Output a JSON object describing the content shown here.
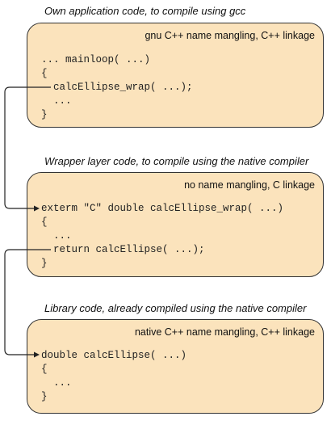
{
  "sections": [
    {
      "caption": "Own application code, to compile using gcc",
      "title": "gnu C++ name mangling, C++ linkage",
      "lines": [
        "... mainloop( ...)",
        "{",
        "  calcEllipse_wrap( ...);",
        "  ...",
        "}"
      ]
    },
    {
      "caption": "Wrapper layer code, to compile using the native compiler",
      "title": "no name mangling, C linkage",
      "lines": [
        "exterm \"C\" double calcEllipse_wrap( ...)",
        "{",
        "  ...",
        "  return calcEllipse( ...);",
        "}"
      ]
    },
    {
      "caption": "Library code, already compiled using the native compiler",
      "title": "native C++ name mangling, C++ linkage",
      "lines": [
        "double calcEllipse( ...)",
        "{",
        "  ...",
        "}"
      ]
    }
  ],
  "colors": {
    "box_fill": "#fbe3bc",
    "box_border": "#333333",
    "arrow": "#222222"
  }
}
